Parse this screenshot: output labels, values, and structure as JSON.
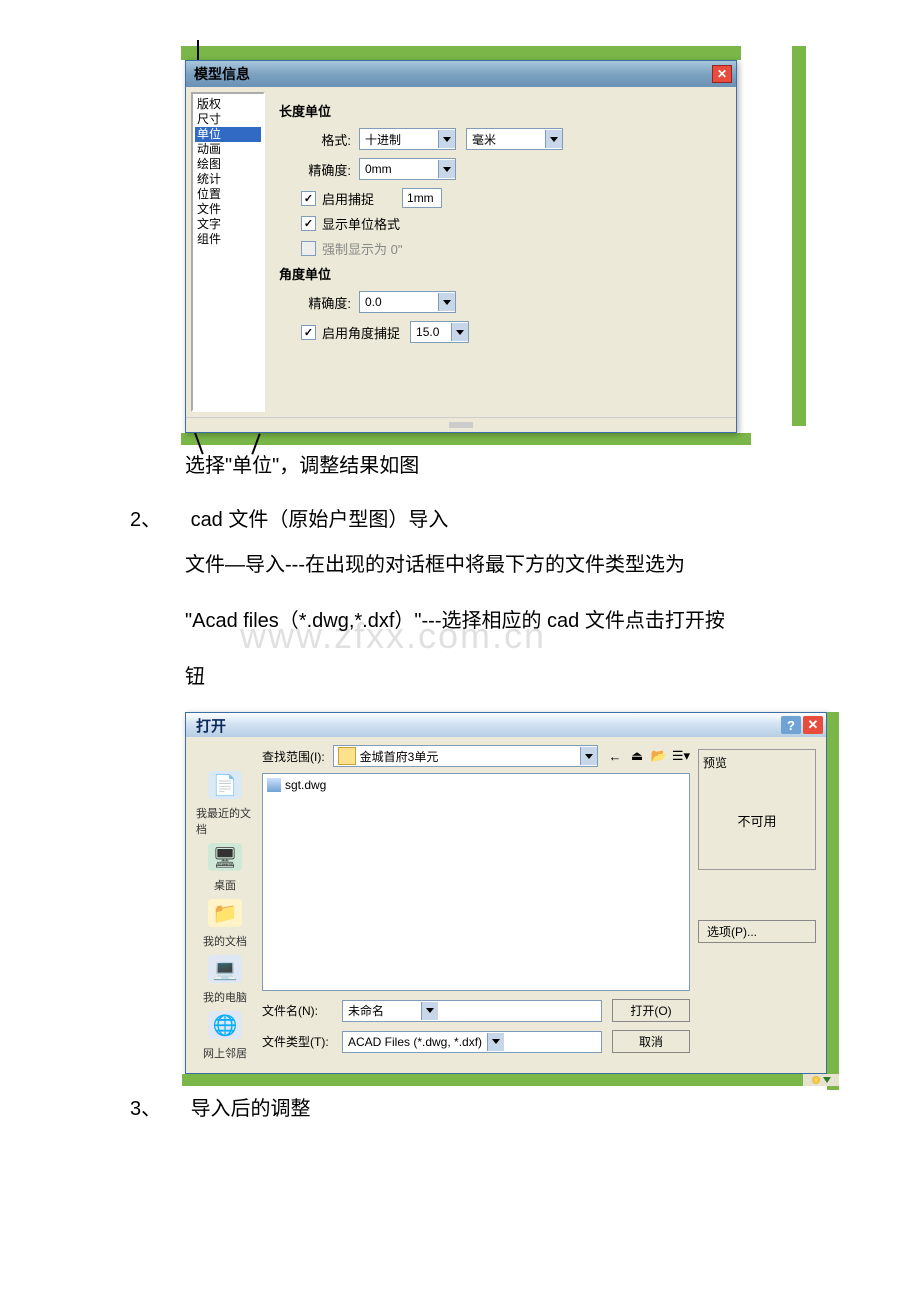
{
  "modelInfo": {
    "title": "模型信息",
    "side": [
      "版权",
      "尺寸",
      "单位",
      "动画",
      "绘图",
      "统计",
      "位置",
      "文件",
      "文字",
      "组件"
    ],
    "sideSelected": "单位",
    "lengthHeader": "长度单位",
    "formatLabel": "格式:",
    "formatValue": "十进制",
    "formatUnit": "毫米",
    "precisionLabel": "精确度:",
    "precisionValue": "0mm",
    "enableSnap": "启用捕捉",
    "snapValue": "1mm",
    "showUnits": "显示单位格式",
    "forceZero": "强制显示为 0\"",
    "angleHeader": "角度单位",
    "anglePrecisionLabel": "精确度:",
    "anglePrecisionValue": "0.0",
    "enableAngleSnap": "启用角度捕捉",
    "angleSnapValue": "15.0"
  },
  "bodyText": {
    "line1": "选择\"单位\"，调整结果如图",
    "item2num": "2、",
    "item2": "cad 文件（原始户型图）导入",
    "para2a": "文件—导入---在出现的对话框中将最下方的文件类型选为",
    "para2b": "\"Acad files（*.dwg,*.dxf）\"---选择相应的 cad 文件点击打开按",
    "para2c": "钮",
    "item3num": "3、",
    "item3": "导入后的调整"
  },
  "watermark": "www.zfxx.com.cn",
  "openDlg": {
    "title": "打开",
    "lookInLabel": "查找范围(I):",
    "folderName": "金城首府3单元",
    "fileShown": "sgt.dwg",
    "places": [
      "我最近的文档",
      "桌面",
      "我的文档",
      "我的电脑",
      "网上邻居"
    ],
    "fileNameLabel": "文件名(N):",
    "fileNameValue": "未命名",
    "fileTypeLabel": "文件类型(T):",
    "fileTypeValue": "ACAD Files (*.dwg, *.dxf)",
    "openBtn": "打开(O)",
    "cancelBtn": "取消",
    "previewLabel": "预览",
    "previewNA": "不可用",
    "optionsBtn": "选项(P)..."
  }
}
